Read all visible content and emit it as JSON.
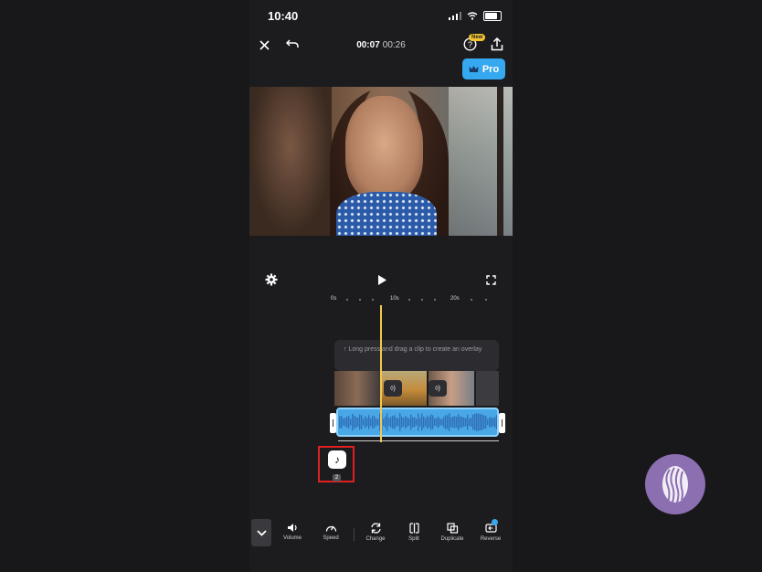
{
  "status": {
    "time": "10:40"
  },
  "header": {
    "current_time": "00:07",
    "total_time": "00:26",
    "new_badge": "New",
    "pro_label": "Pro"
  },
  "timeline": {
    "ruler": [
      "0s",
      "10s",
      "20s"
    ],
    "hint": "Long press and drag a clip to create an overlay",
    "music_count": "2"
  },
  "toolbar": {
    "items": [
      {
        "label": "Volume",
        "icon": "volume-icon"
      },
      {
        "label": "Speed",
        "icon": "speed-icon"
      },
      {
        "label": "Change",
        "icon": "change-icon"
      },
      {
        "label": "Split",
        "icon": "split-icon"
      },
      {
        "label": "Duplicate",
        "icon": "duplicate-icon"
      },
      {
        "label": "Reverse",
        "icon": "reverse-icon"
      }
    ]
  },
  "colors": {
    "accent": "#35a8f0",
    "audio": "#4aa7e6",
    "playhead": "#f2c94c",
    "highlight": "#e02020",
    "logo": "#8b6fb0"
  }
}
